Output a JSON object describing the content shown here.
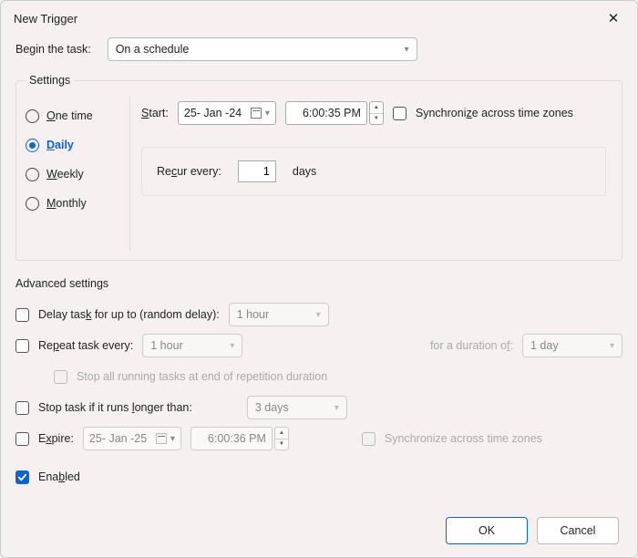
{
  "window": {
    "title": "New Trigger"
  },
  "begin": {
    "label": "Begin the task:",
    "selected": "On a schedule"
  },
  "settings": {
    "legend": "Settings",
    "radios": {
      "onetime": "One time",
      "daily": "Daily",
      "weekly": "Weekly",
      "monthly": "Monthly",
      "selected": "daily"
    },
    "start_label": "Start:",
    "start_date": "25- Jan -24",
    "start_time": "6:00:35 PM",
    "sync_label": "Synchronize across time zones",
    "recur": {
      "label": "Recur every:",
      "value": "1",
      "unit": "days"
    }
  },
  "advanced": {
    "legend": "Advanced settings",
    "delay_label": "Delay task for up to (random delay):",
    "delay_value": "1 hour",
    "repeat_label": "Repeat task every:",
    "repeat_value": "1 hour",
    "duration_label": "for a duration of:",
    "duration_value": "1 day",
    "stop_repetition_label": "Stop all running tasks at end of repetition duration",
    "stop_longer_label": "Stop task if it runs longer than:",
    "stop_longer_value": "3 days",
    "expire_label": "Expire:",
    "expire_date": "25- Jan -25",
    "expire_time": "6:00:36 PM",
    "expire_sync_label": "Synchronize across time zones",
    "enabled_label": "Enabled"
  },
  "buttons": {
    "ok": "OK",
    "cancel": "Cancel"
  }
}
